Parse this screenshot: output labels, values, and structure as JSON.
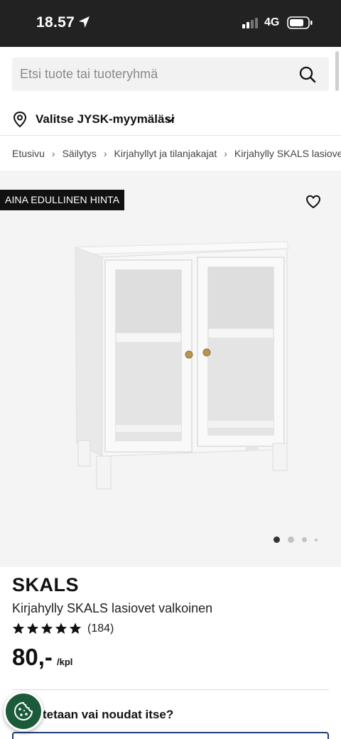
{
  "status_bar": {
    "time": "18.57",
    "network": "4G"
  },
  "search": {
    "placeholder": "Etsi tuote tai tuoteryhmä"
  },
  "store_selector": {
    "label": "Valitse JYSK-myymäläsi"
  },
  "breadcrumb": [
    "Etusivu",
    "Säilytys",
    "Kirjahyllyt ja tilanjakajat",
    "Kirjahylly SKALS lasiovet valkoinen"
  ],
  "gallery": {
    "badge": "AINA EDULLINEN HINTA",
    "image_count": 4,
    "active_index": 0
  },
  "product": {
    "brand": "SKALS",
    "name": "Kirjahylly SKALS lasiovet valkoinen",
    "rating": 5,
    "review_count": "(184)",
    "price": "80,-",
    "price_unit": "/kpl"
  },
  "delivery": {
    "question": "tetaan vai noudat itse?"
  },
  "colors": {
    "status_bar": "#222222",
    "badge_bg": "#111111",
    "cookie_button": "#1c5b3a",
    "delivery_border": "#1f3d73"
  },
  "icons": [
    "location-arrow-icon",
    "signal-icon",
    "battery-icon",
    "search-icon",
    "map-pin-icon",
    "chevron-down-icon",
    "chevron-right-icon",
    "heart-icon",
    "star-icon",
    "cookie-icon"
  ]
}
